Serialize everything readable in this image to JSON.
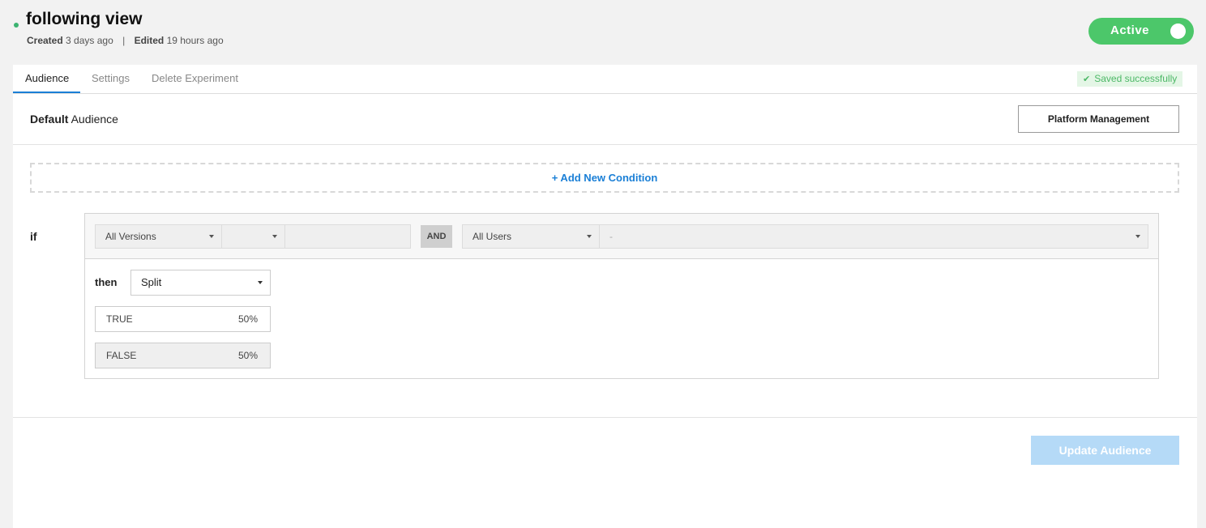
{
  "experiment": {
    "title": "following view",
    "created_label": "Created",
    "created_value": "3 days ago",
    "separator": "|",
    "edited_label": "Edited",
    "edited_value": "19 hours ago",
    "status_toggle_label": "Active"
  },
  "tabs": [
    {
      "label": "Audience",
      "active": true
    },
    {
      "label": "Settings",
      "active": false
    },
    {
      "label": "Delete Experiment",
      "active": false
    }
  ],
  "save_status": "Saved successfully",
  "audience": {
    "title_bold": "Default",
    "title_rest": "Audience",
    "platform_button": "Platform Management",
    "add_condition": "+ Add New Condition",
    "if_label": "if",
    "condition": {
      "versions_select": "All Versions",
      "operator_select": "",
      "version_value": "",
      "and_label": "AND",
      "users_select": "All Users",
      "users_value": "-"
    },
    "then_label": "then",
    "then_select": "Split",
    "variations": [
      {
        "name": "TRUE",
        "percent": "50%"
      },
      {
        "name": "FALSE",
        "percent": "50%"
      }
    ],
    "update_button": "Update Audience"
  },
  "colors": {
    "accent": "#1a7fd6",
    "active_green": "#4cc76a",
    "saved_bg": "#e4f6e6",
    "update_disabled": "#b5daf7"
  }
}
